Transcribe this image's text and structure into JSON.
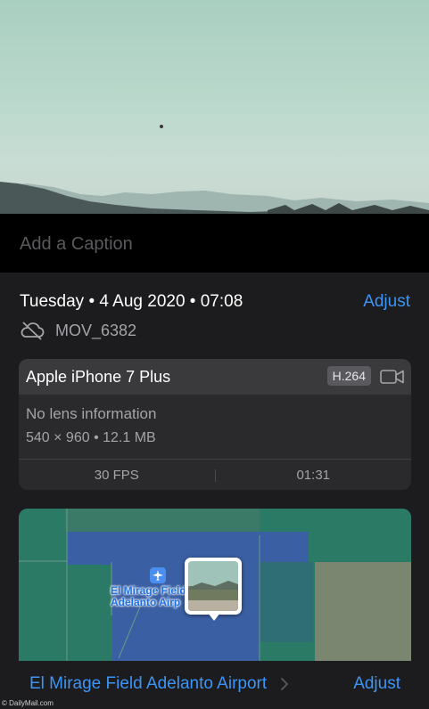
{
  "caption": {
    "placeholder": "Add a Caption"
  },
  "info": {
    "date_time": "Tuesday • 4 Aug 2020 • 07:08",
    "adjust_label": "Adjust",
    "file_name": "MOV_6382",
    "file_icon": "cloud-slash-icon"
  },
  "device": {
    "name": "Apple iPhone 7 Plus",
    "codec": "H.264",
    "media_icon": "video-camera-icon",
    "lens": "No lens information",
    "specs": "540 × 960  •  12.1 MB",
    "fps": "30 FPS",
    "duration": "01:31"
  },
  "map": {
    "place_label": "El Mirage Field Adelanto Airp",
    "place_icon": "airplane-icon",
    "location_name": "El Mirage Field Adelanto Airport",
    "adjust_label": "Adjust"
  },
  "watermark": "© DailyMail.com",
  "colors": {
    "accent": "#3c94f5",
    "background": "#1c1c1e",
    "map_green": "#2b7a66",
    "map_blue": "#3a5fa3"
  }
}
